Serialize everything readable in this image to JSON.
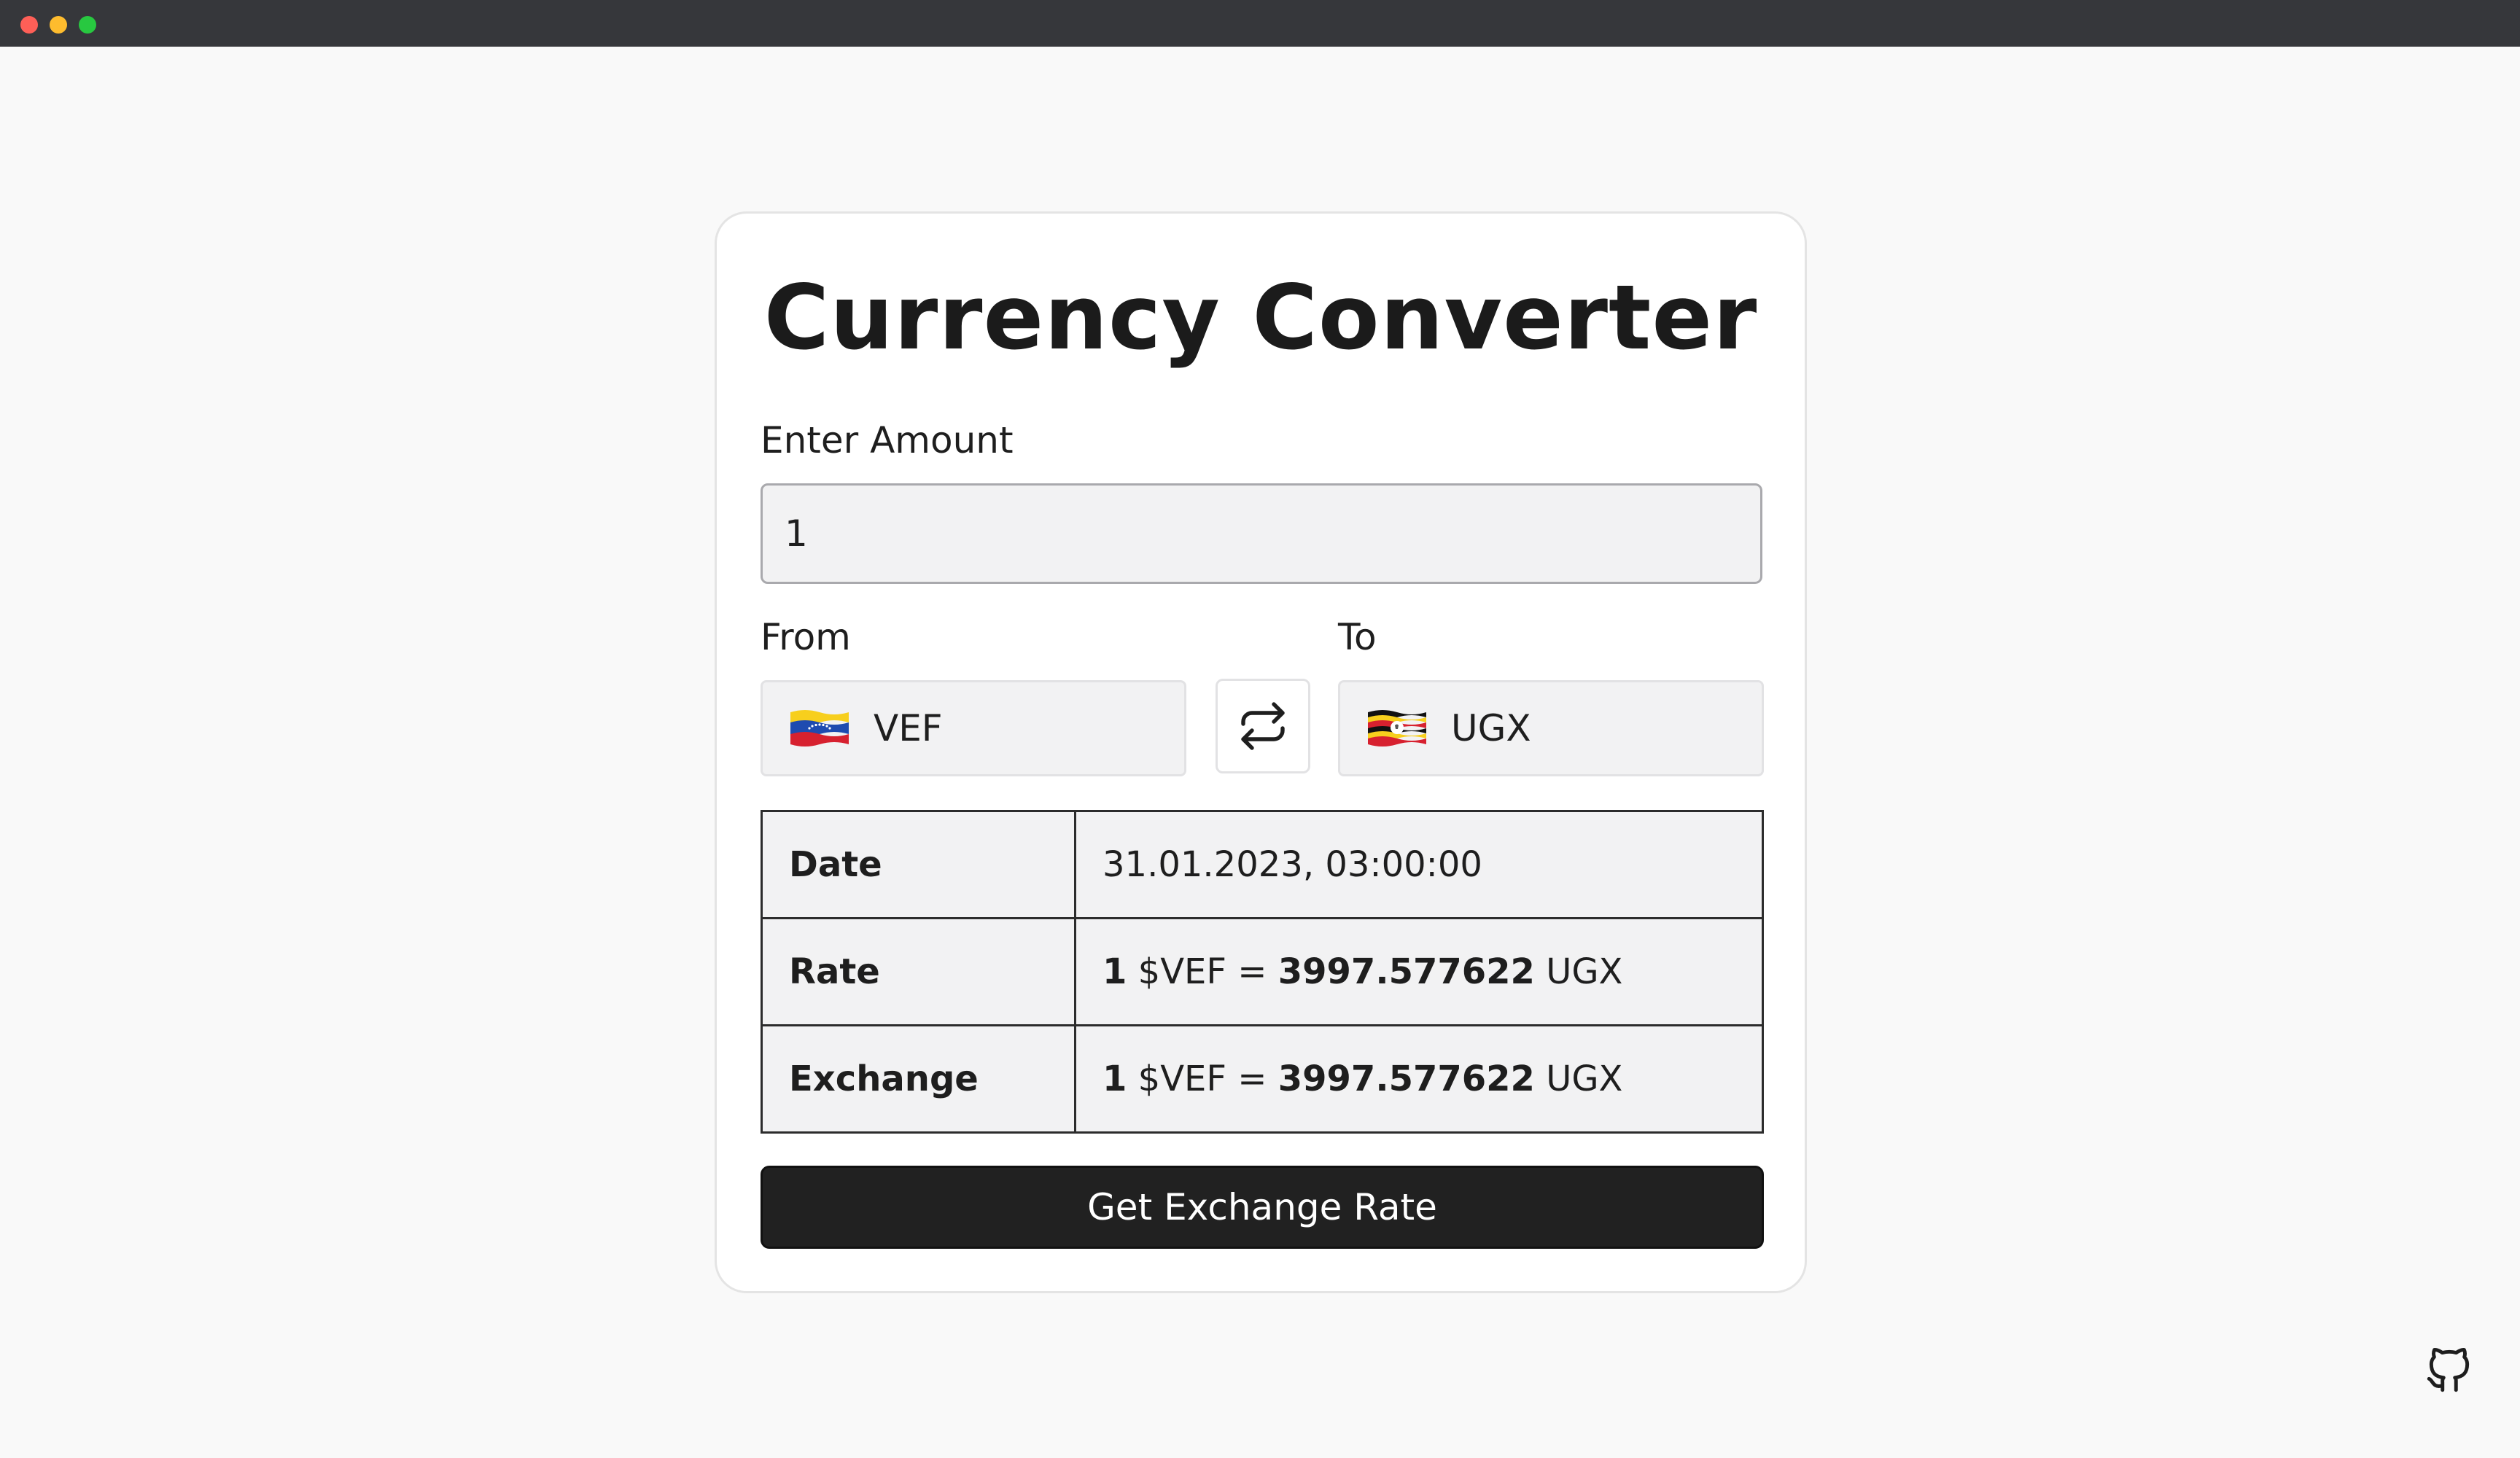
{
  "window": {
    "controls": [
      "close",
      "minimize",
      "maximize"
    ]
  },
  "card": {
    "title": "Currency Converter",
    "amount": {
      "label": "Enter Amount",
      "value": "1"
    },
    "from": {
      "label": "From",
      "code": "VEF",
      "flag_icon": "venezuela-flag-icon"
    },
    "to": {
      "label": "To",
      "code": "UGX",
      "flag_icon": "uganda-flag-icon"
    },
    "swap_icon": "swap-arrows-icon",
    "table": {
      "date": {
        "key": "Date",
        "value": "31.01.2023, 03:00:00"
      },
      "rate": {
        "key": "Rate",
        "amount": "1",
        "from": "$VEF",
        "equals": "=",
        "result": "3997.577622",
        "to": "UGX"
      },
      "exchange": {
        "key": "Exchange",
        "amount": "1",
        "from": "$VEF",
        "equals": "=",
        "result": "3997.577622",
        "to": "UGX"
      }
    },
    "button_label": "Get Exchange Rate"
  },
  "github_icon": "github-icon",
  "colors": {
    "background": "#f9f9f9",
    "card": "#ffffff",
    "field": "#f2f2f3",
    "button": "#212121",
    "titlebar": "#36373b"
  }
}
